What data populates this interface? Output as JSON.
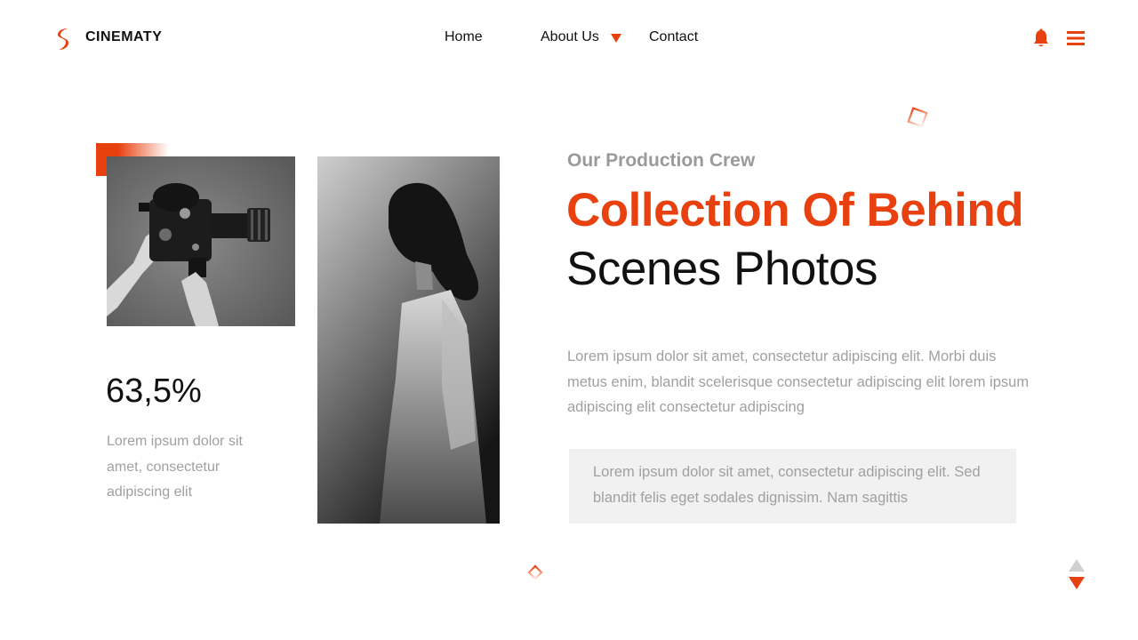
{
  "header": {
    "brand": "CINEMATY",
    "nav": [
      {
        "label": "Home"
      },
      {
        "label": "About Us"
      },
      {
        "label": "Contact"
      }
    ]
  },
  "stats": {
    "value": "63,5%",
    "description": "Lorem ipsum dolor sit amet, consectetur adipiscing elit"
  },
  "content": {
    "eyebrow": "Our Production Crew",
    "title_line1": "Collection Of Behind",
    "title_line2": "Scenes Photos",
    "paragraph": "Lorem ipsum dolor sit amet, consectetur adipiscing elit. Morbi duis metus enim, blandit scelerisque consectetur adipiscing elit lorem ipsum adipiscing elit consectetur adipiscing",
    "quote": "Lorem ipsum dolor sit amet, consectetur adipiscing elit. Sed blandit felis eget sodales dignissim. Nam sagittis"
  },
  "colors": {
    "accent": "#e8400f",
    "text": "#111111",
    "muted": "#a0a0a0",
    "quote_bg": "#f1f1f1"
  },
  "icons": {
    "logo": "brand-s-logo-icon",
    "bell": "bell-icon",
    "menu": "hamburger-menu-icon",
    "caret": "chevron-down-icon",
    "pager_up": "triangle-up-icon",
    "pager_down": "triangle-down-icon"
  }
}
